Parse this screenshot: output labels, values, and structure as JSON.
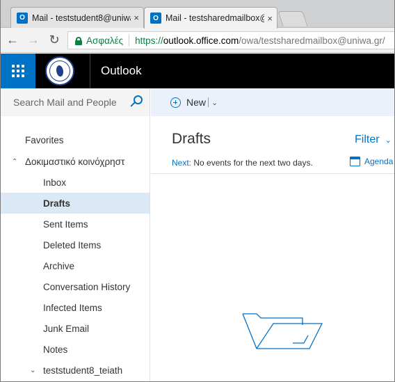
{
  "browser": {
    "tabs": [
      {
        "favicon": "outlook-icon",
        "title": "Mail - teststudent8@uniwa",
        "close": "×",
        "active": false
      },
      {
        "favicon": "outlook-icon",
        "title": "Mail - testsharedmailbox@",
        "close": "×",
        "active": true
      }
    ],
    "address": {
      "secure_label": "Ασφαλές",
      "scheme": "https://",
      "host": "outlook.office.com",
      "path": "/owa/testsharedmailbox@uniwa.gr/"
    }
  },
  "app": {
    "title": "Outlook",
    "brand_color": "#0072c6"
  },
  "search": {
    "placeholder": "Search Mail and People"
  },
  "sidebar": {
    "favorites_label": "Favorites",
    "group_label": "Δοκιμαστικό κοινόχρηστ",
    "folders": [
      {
        "label": "Inbox",
        "selected": false
      },
      {
        "label": "Drafts",
        "selected": true
      },
      {
        "label": "Sent Items",
        "selected": false
      },
      {
        "label": "Deleted Items",
        "selected": false
      },
      {
        "label": "Archive",
        "selected": false
      },
      {
        "label": "Conversation History",
        "selected": false
      },
      {
        "label": "Infected Items",
        "selected": false
      },
      {
        "label": "Junk Email",
        "selected": false
      },
      {
        "label": "Notes",
        "selected": false
      }
    ],
    "sub_account": "teststudent8_teiath"
  },
  "toolbar": {
    "new_label": "New"
  },
  "main": {
    "folder_title": "Drafts",
    "filter_label": "Filter",
    "next_label": "Next:",
    "next_text": "No events for the next two days.",
    "agenda_label": "Agenda"
  }
}
